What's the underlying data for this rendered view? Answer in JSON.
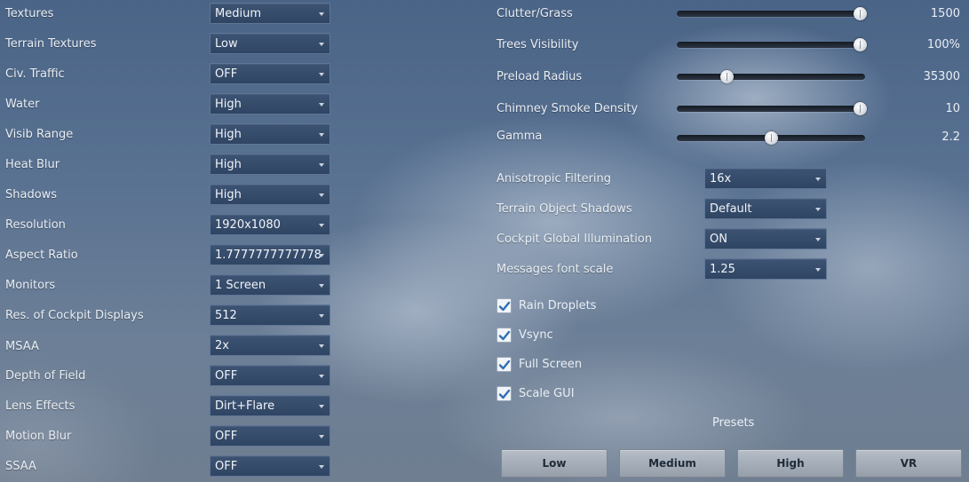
{
  "left_settings": [
    {
      "label": "Textures",
      "value": "Medium"
    },
    {
      "label": "Terrain Textures",
      "value": "Low"
    },
    {
      "label": "Civ. Traffic",
      "value": "OFF"
    },
    {
      "label": "Water",
      "value": "High"
    },
    {
      "label": "Visib Range",
      "value": "High"
    },
    {
      "label": "Heat Blur",
      "value": "High"
    },
    {
      "label": "Shadows",
      "value": "High"
    },
    {
      "label": "Resolution",
      "value": "1920x1080"
    },
    {
      "label": "Aspect Ratio",
      "value": "1.7777777777778"
    },
    {
      "label": "Monitors",
      "value": "1 Screen"
    },
    {
      "label": "Res. of Cockpit Displays",
      "value": "512"
    },
    {
      "label": "MSAA",
      "value": "2x"
    },
    {
      "label": "Depth of Field",
      "value": "OFF"
    },
    {
      "label": "Lens Effects",
      "value": "Dirt+Flare"
    },
    {
      "label": "Motion Blur",
      "value": "OFF"
    },
    {
      "label": "SSAA",
      "value": "OFF"
    }
  ],
  "sliders": [
    {
      "label": "Clutter/Grass",
      "value": "1500",
      "level": 1.0
    },
    {
      "label": "Trees Visibility",
      "value": "100%",
      "level": 1.0
    },
    {
      "label": "Preload Radius",
      "value": "35300",
      "level": 0.25
    },
    {
      "label": "Chimney Smoke Density",
      "value": "10",
      "level": 1.0
    },
    {
      "label": "Gamma",
      "value": "2.2",
      "level": 0.5
    }
  ],
  "right_settings": [
    {
      "label": "Anisotropic Filtering",
      "value": "16x"
    },
    {
      "label": "Terrain Object Shadows",
      "value": "Default"
    },
    {
      "label": "Cockpit Global Illumination",
      "value": "ON"
    },
    {
      "label": "Messages font scale",
      "value": "1.25"
    }
  ],
  "checkboxes": [
    {
      "label": "Rain Droplets",
      "checked": true
    },
    {
      "label": "Vsync",
      "checked": true
    },
    {
      "label": "Full Screen",
      "checked": true
    },
    {
      "label": "Scale GUI",
      "checked": true
    }
  ],
  "presets": {
    "title": "Presets",
    "buttons": [
      "Low",
      "Medium",
      "High",
      "VR"
    ]
  },
  "colors": {
    "checkmark": "#2f6fb3",
    "accent": "#34496a"
  }
}
